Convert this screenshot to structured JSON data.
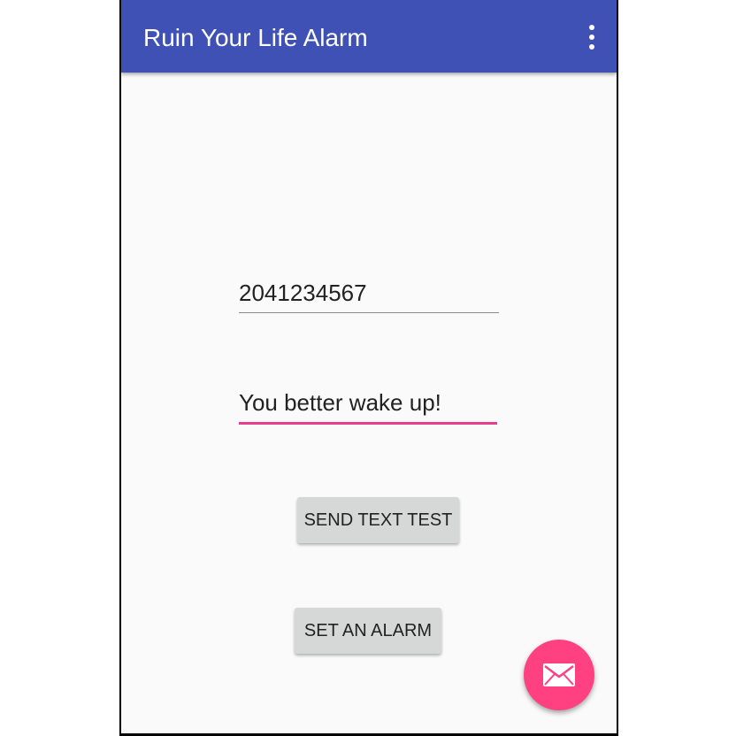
{
  "appbar": {
    "title": "Ruin Your Life Alarm",
    "menu_icon": "more-vert-icon",
    "color": "#3f51b5"
  },
  "form": {
    "phone_value": "2041234567",
    "message_value": "You better wake up!",
    "accent_color": "#e83e8c"
  },
  "buttons": {
    "send_text_test": "SEND TEXT TEST",
    "set_alarm": "SET AN ALARM"
  },
  "fab": {
    "icon": "email-icon",
    "color": "#ff4081"
  }
}
